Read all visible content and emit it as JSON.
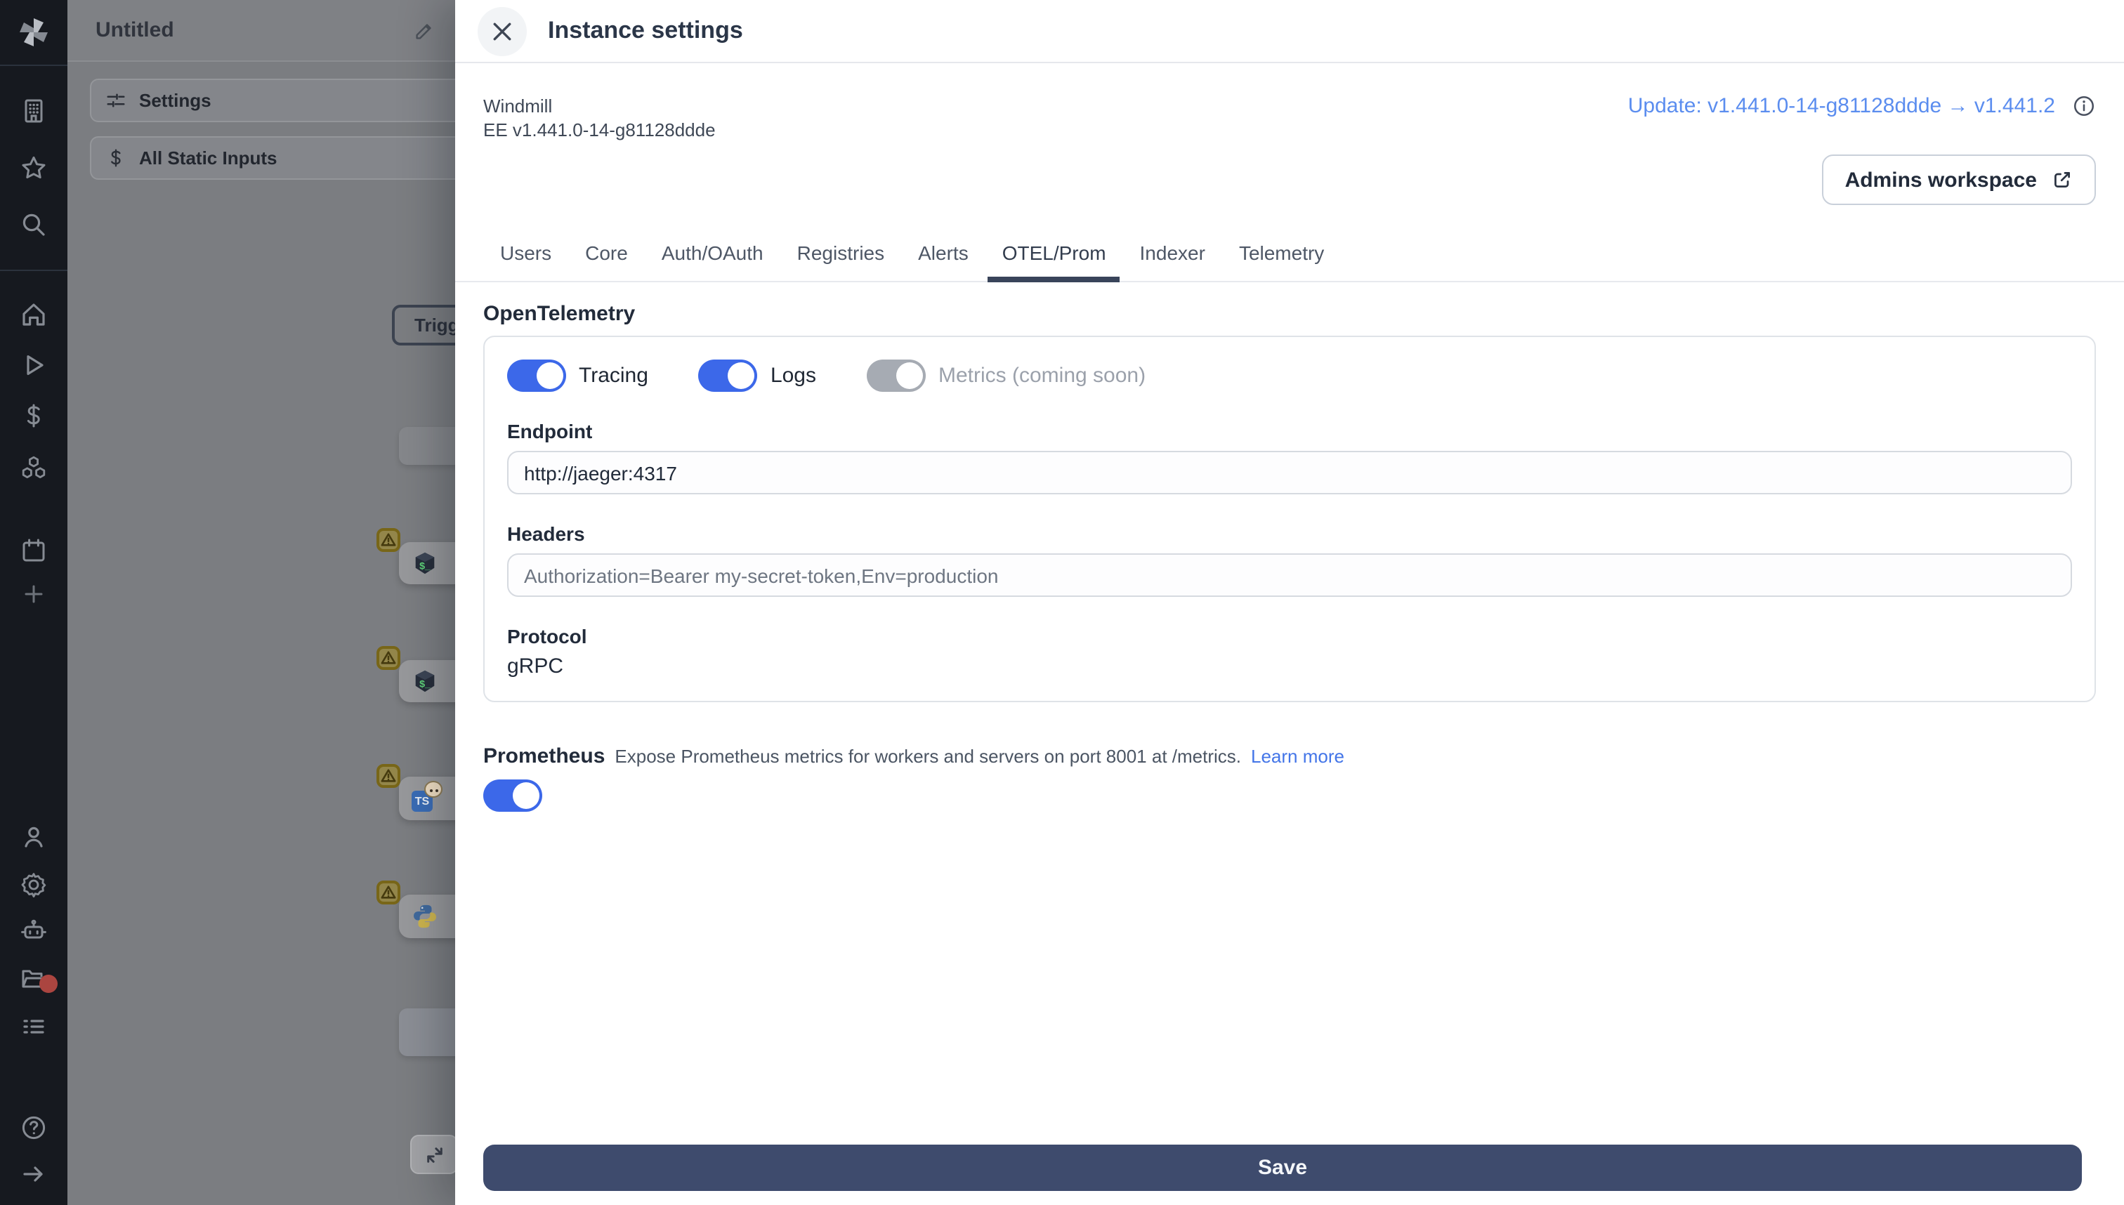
{
  "sidebar": {
    "icon_names": [
      "windmill-logo",
      "building-icon",
      "star-icon",
      "search-icon",
      "home-icon",
      "play-icon",
      "dollar-icon",
      "cubes-icon",
      "calendar-icon",
      "plus-icon",
      "user-icon",
      "gear-icon",
      "robot-icon",
      "folder-icon",
      "runs-list-icon",
      "help-icon",
      "expand-arrow-icon"
    ],
    "notification_dot": true
  },
  "flow": {
    "title": "Untitled",
    "toolbar": [
      {
        "label": "Settings",
        "icon": "sliders-icon"
      },
      {
        "label": "All Static Inputs",
        "icon": "dollar-icon"
      }
    ],
    "trigger_label": "Trigg",
    "nodes": [
      {
        "icon": "bash-script-icon",
        "warning": true
      },
      {
        "icon": "bash-script-icon",
        "warning": true
      },
      {
        "icon": "typescript-bun-icon",
        "warning": true
      },
      {
        "icon": "python-icon",
        "warning": true
      }
    ]
  },
  "modal": {
    "title": "Instance settings",
    "app_name": "Windmill",
    "edition_version": "EE v1.441.0-14-g81128ddde",
    "update_link": "Update: v1.441.0-14-g81128ddde → v1.441.2",
    "admins_workspace_button": "Admins workspace",
    "tabs": [
      "Users",
      "Core",
      "Auth/OAuth",
      "Registries",
      "Alerts",
      "OTEL/Prom",
      "Indexer",
      "Telemetry"
    ],
    "active_tab": "OTEL/Prom",
    "otel": {
      "heading": "OpenTelemetry",
      "toggles": [
        {
          "label": "Tracing",
          "state": "on"
        },
        {
          "label": "Logs",
          "state": "on"
        },
        {
          "label": "Metrics (coming soon)",
          "state": "disabled"
        }
      ],
      "endpoint": {
        "label": "Endpoint",
        "value": "http://jaeger:4317"
      },
      "headers": {
        "label": "Headers",
        "placeholder": "Authorization=Bearer my-secret-token,Env=production"
      },
      "protocol": {
        "label": "Protocol",
        "value": "gRPC"
      }
    },
    "prometheus": {
      "heading": "Prometheus",
      "description": "Expose Prometheus metrics for workers and servers on port 8001 at /metrics.",
      "learn_more": "Learn more",
      "enabled": true
    },
    "save_button": "Save"
  },
  "colors": {
    "accent_blue": "#3c68e9",
    "link_blue": "#5b8def",
    "learn_more_blue": "#4375e8",
    "save_navy": "#3e4b6d",
    "sidebar_bg": "#16191f",
    "warning_badge": "#93864a",
    "notification_red": "#ab4540"
  }
}
